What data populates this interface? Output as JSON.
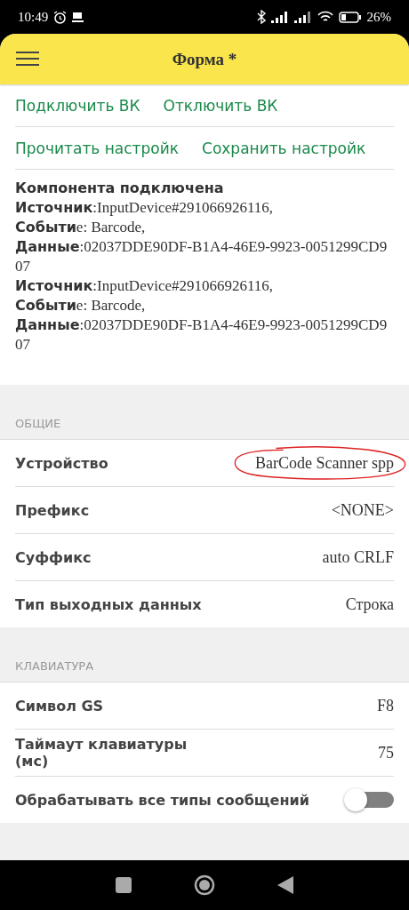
{
  "status_bar": {
    "time": "10:49",
    "battery": "26%"
  },
  "header": {
    "title": "Форма *"
  },
  "link_rows": [
    [
      "Подключить ВК",
      "Отключить ВК"
    ],
    [
      "Прочитать настройк",
      "Сохранить настройк"
    ]
  ],
  "log": [
    "**Компонента подключена**",
    "**Источник**:InputDevice#291066926116,",
    "**Событи**e: Barcode,",
    "**Данные**:02037DDE90DF-B1A4-46E9-9923-0051299CD907",
    "**Источник**:InputDevice#291066926116,",
    "**Событи**e: Barcode,",
    "**Данные**:02037DDE90DF-B1A4-46E9-9923-0051299CD907"
  ],
  "sections": [
    {
      "title": "ОБЩИЕ",
      "rows": [
        {
          "kind": "value",
          "label": "Устройство",
          "value": "BarCode Scanner spp",
          "highlighted": true
        },
        {
          "kind": "value",
          "label": "Префикс",
          "value": "<NONE>",
          "highlighted": false
        },
        {
          "kind": "value",
          "label": "Суффикс",
          "value": "auto CRLF",
          "highlighted": false
        },
        {
          "kind": "value",
          "label": "Тип выходных данных",
          "value": "Строка",
          "highlighted": false
        }
      ]
    },
    {
      "title": "КЛАВИАТУРА",
      "rows": [
        {
          "kind": "value",
          "label": "Символ GS",
          "value": "F8",
          "highlighted": false
        },
        {
          "kind": "value",
          "label": "Таймаут клавиатуры (мс)",
          "value": "75",
          "highlighted": false
        },
        {
          "kind": "toggle",
          "label": "Обрабатывать все типы сообщений",
          "on": false
        }
      ]
    }
  ]
}
